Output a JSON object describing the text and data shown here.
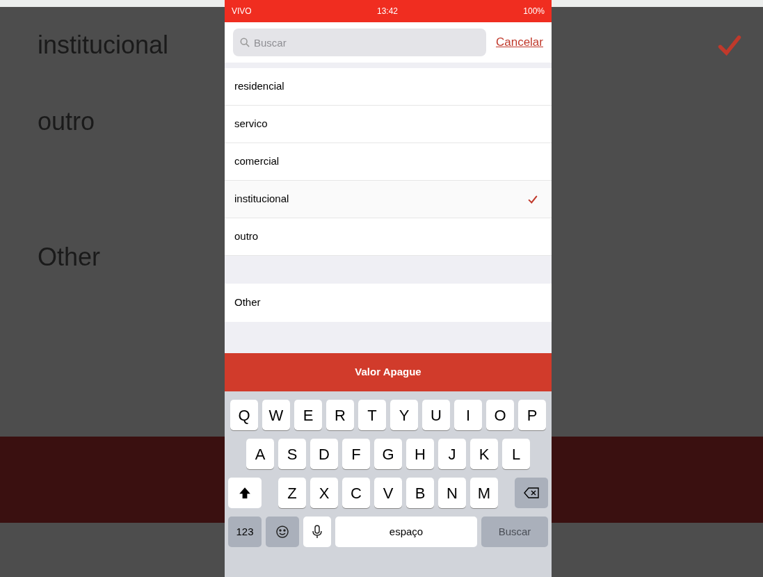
{
  "backdrop": {
    "labels": [
      "institucional",
      "outro",
      "Other"
    ],
    "checked": true
  },
  "status_bar": {
    "carrier": "VIVO",
    "time": "13:42",
    "battery": "100%"
  },
  "search": {
    "placeholder": "Buscar",
    "cancel": "Cancelar"
  },
  "options": [
    {
      "label": "residencial",
      "selected": false
    },
    {
      "label": "servico",
      "selected": false
    },
    {
      "label": "comercial",
      "selected": false
    },
    {
      "label": "institucional",
      "selected": true
    },
    {
      "label": "outro",
      "selected": false
    }
  ],
  "other": {
    "label": "Other"
  },
  "action_button": "Valor Apague",
  "keyboard": {
    "rows": [
      [
        "Q",
        "W",
        "E",
        "R",
        "T",
        "Y",
        "U",
        "I",
        "O",
        "P"
      ],
      [
        "A",
        "S",
        "D",
        "F",
        "G",
        "H",
        "J",
        "K",
        "L"
      ],
      [
        "Z",
        "X",
        "C",
        "V",
        "B",
        "N",
        "M"
      ]
    ],
    "numbers": "123",
    "space": "espaço",
    "search": {
      "label": "Buscar",
      "disabled": true
    }
  }
}
